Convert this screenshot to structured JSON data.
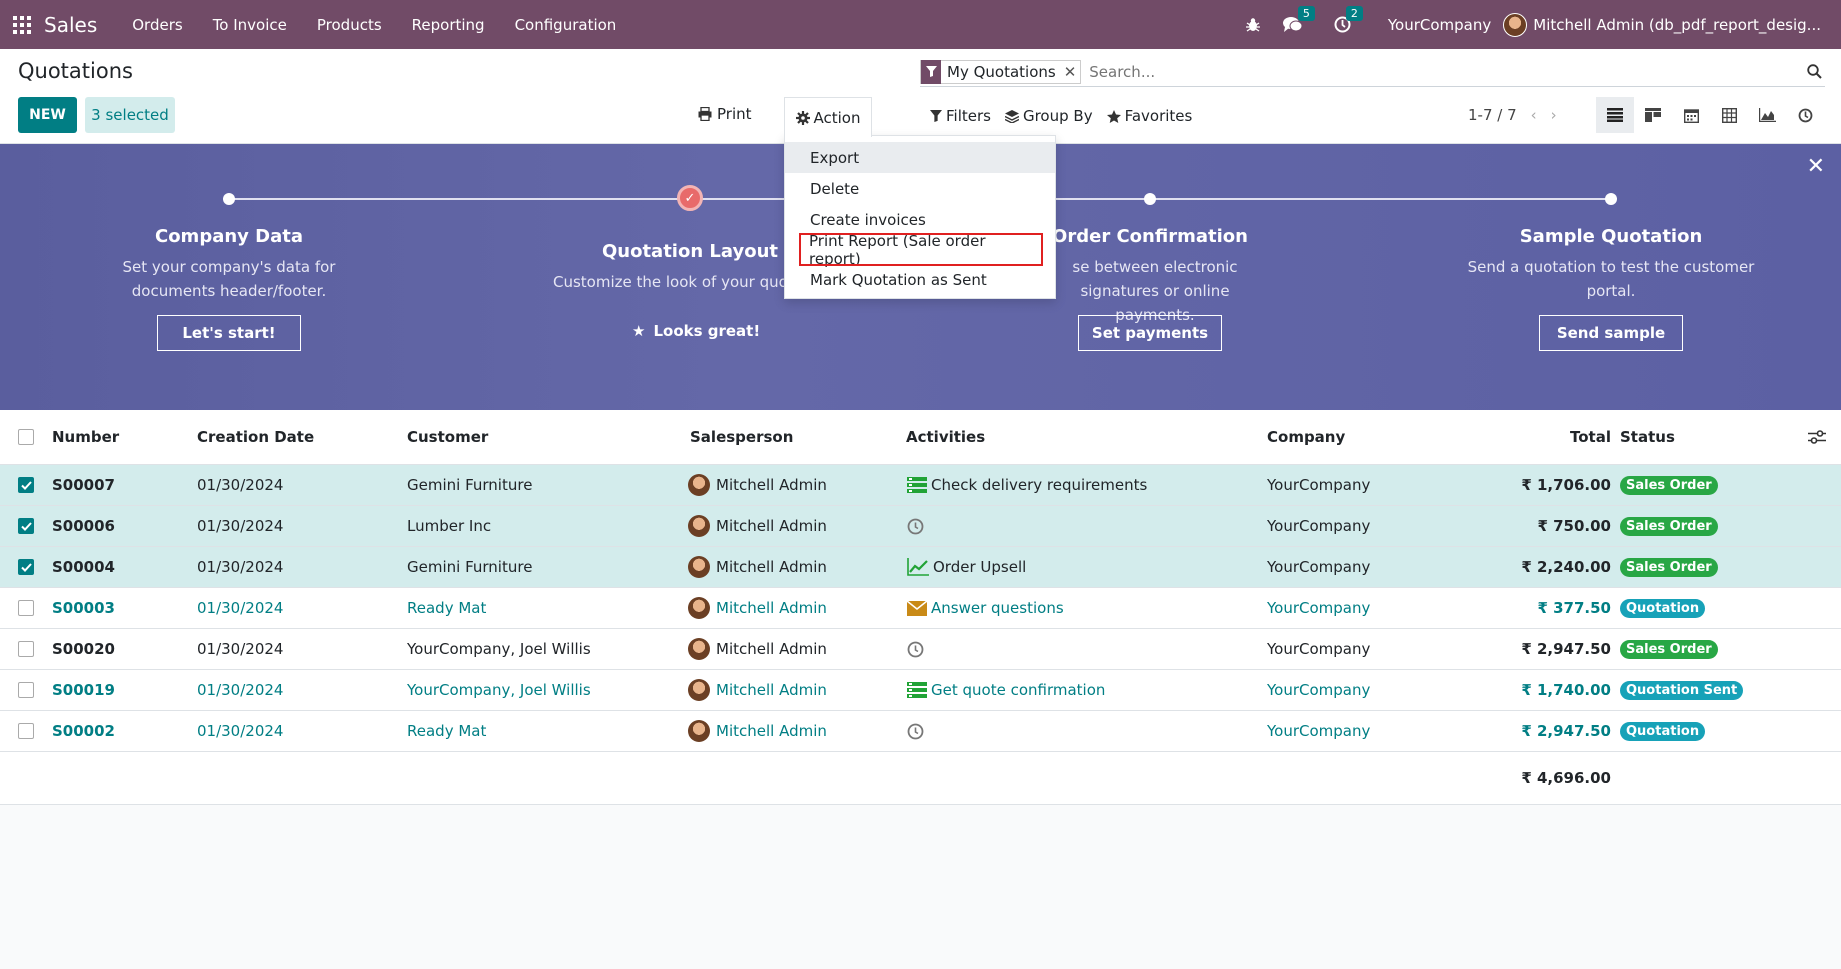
{
  "navbar": {
    "app": "Sales",
    "menu": [
      "Orders",
      "To Invoice",
      "Products",
      "Reporting",
      "Configuration"
    ],
    "messages_count": "5",
    "activities_count": "2",
    "company": "YourCompany",
    "user": "Mitchell Admin (db_pdf_report_desig..."
  },
  "control": {
    "breadcrumb": "Quotations",
    "new_label": "NEW",
    "selected_label": "3 selected",
    "print_label": "Print",
    "action_label": "Action",
    "facet_label": "My Quotations",
    "search_placeholder": "Search...",
    "filters_label": "Filters",
    "groupby_label": "Group By",
    "favorites_label": "Favorites",
    "pager": "1-7 / 7"
  },
  "action_menu": [
    "Export",
    "Delete",
    "Create invoices",
    "Print Report (Sale order report)",
    "Mark Quotation as Sent"
  ],
  "banner": {
    "steps": [
      {
        "title": "Company Data",
        "desc": "Set your company's data for documents header/footer.",
        "button": "Let's start!"
      },
      {
        "title": "Quotation Layout",
        "desc": "Customize the look of your quota",
        "button": "Looks great!"
      },
      {
        "title": "Order Confirmation",
        "desc": "se between electronic signatures or online payments.",
        "button": "Set payments"
      },
      {
        "title": "Sample Quotation",
        "desc": "Send a quotation to test the customer portal.",
        "button": "Send sample"
      }
    ]
  },
  "table": {
    "headers": {
      "number": "Number",
      "date": "Creation Date",
      "customer": "Customer",
      "salesperson": "Salesperson",
      "activities": "Activities",
      "company": "Company",
      "total": "Total",
      "status": "Status"
    },
    "rows": [
      {
        "number": "S00007",
        "date": "01/30/2024",
        "customer": "Gemini Furniture",
        "salesperson": "Mitchell Admin",
        "activity": "Check delivery requirements",
        "activity_icon": "list-icon",
        "company": "YourCompany",
        "total": "₹ 1,706.00",
        "status": "Sales Order",
        "selected": true,
        "style": "normal"
      },
      {
        "number": "S00006",
        "date": "01/30/2024",
        "customer": "Lumber Inc",
        "salesperson": "Mitchell Admin",
        "activity": "",
        "activity_icon": "clock-icon",
        "company": "YourCompany",
        "total": "₹ 750.00",
        "status": "Sales Order",
        "selected": true,
        "style": "normal"
      },
      {
        "number": "S00004",
        "date": "01/30/2024",
        "customer": "Gemini Furniture",
        "salesperson": "Mitchell Admin",
        "activity": "Order Upsell",
        "activity_icon": "chart-icon",
        "company": "YourCompany",
        "total": "₹ 2,240.00",
        "status": "Sales Order",
        "selected": true,
        "style": "normal"
      },
      {
        "number": "S00003",
        "date": "01/30/2024",
        "customer": "Ready Mat",
        "salesperson": "Mitchell Admin",
        "activity": "Answer questions",
        "activity_icon": "envelope-icon",
        "company": "YourCompany",
        "total": "₹ 377.50",
        "status": "Quotation",
        "selected": false,
        "style": "link"
      },
      {
        "number": "S00020",
        "date": "01/30/2024",
        "customer": "YourCompany, Joel Willis",
        "salesperson": "Mitchell Admin",
        "activity": "",
        "activity_icon": "clock-icon",
        "company": "YourCompany",
        "total": "₹ 2,947.50",
        "status": "Sales Order",
        "selected": false,
        "style": "normal"
      },
      {
        "number": "S00019",
        "date": "01/30/2024",
        "customer": "YourCompany, Joel Willis",
        "salesperson": "Mitchell Admin",
        "activity": "Get quote confirmation",
        "activity_icon": "list-icon",
        "company": "YourCompany",
        "total": "₹ 1,740.00",
        "status": "Quotation Sent",
        "selected": false,
        "style": "link"
      },
      {
        "number": "S00002",
        "date": "01/30/2024",
        "customer": "Ready Mat",
        "salesperson": "Mitchell Admin",
        "activity": "",
        "activity_icon": "clock-icon",
        "company": "YourCompany",
        "total": "₹ 2,947.50",
        "status": "Quotation",
        "selected": false,
        "style": "link"
      }
    ],
    "sum_total": "₹ 4,696.00"
  },
  "colors": {
    "navbar": "#714b67",
    "primary": "#017e84",
    "sales_order": "#28a745",
    "quotation": "#17a2b8",
    "highlight": "#e02020"
  }
}
